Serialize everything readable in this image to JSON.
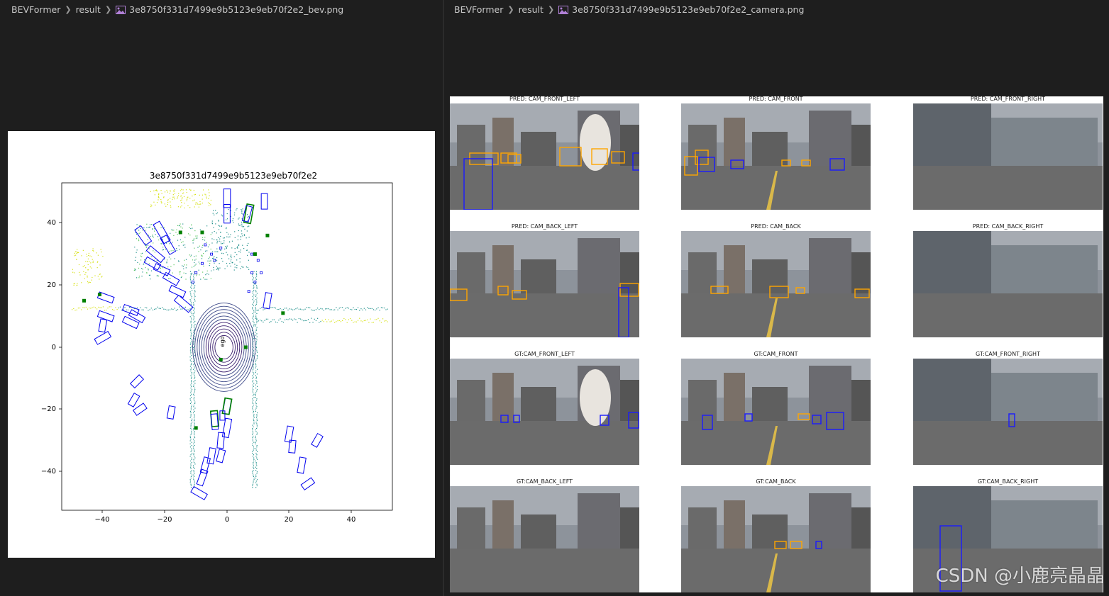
{
  "left_tab": {
    "breadcrumb": [
      "BEVFormer",
      "result",
      "3e8750f331d7499e9b5123e9eb70f2e2_bev.png"
    ],
    "file_icon": "image-file-icon"
  },
  "right_tab": {
    "breadcrumb": [
      "BEVFormer",
      "result",
      "3e8750f331d7499e9b5123e9eb70f2e2_camera.png"
    ],
    "file_icon": "image-file-icon"
  },
  "bev_plot": {
    "title": "3e8750f331d7499e9b5123e9eb70f2e2",
    "ego_label": "ego",
    "x_ticks": [
      "−40",
      "−20",
      "0",
      "20",
      "40"
    ],
    "y_ticks": [
      "40",
      "20",
      "0",
      "−20",
      "−40"
    ],
    "xlim": [
      -53,
      53
    ],
    "ylim": [
      -53,
      53
    ],
    "colors": {
      "pred_box": "#0000ee",
      "gt_box": "#008000",
      "lidar_near": "#3b1f6e",
      "lidar_mid": "#21918c",
      "lidar_far": "#d8e219"
    }
  },
  "camera_grid": {
    "views": [
      {
        "title": "PRED: CAM_FRONT_LEFT"
      },
      {
        "title": "PRED: CAM_FRONT"
      },
      {
        "title": "PRED: CAM_FRONT_RIGHT"
      },
      {
        "title": "PRED: CAM_BACK_LEFT"
      },
      {
        "title": "PRED: CAM_BACK"
      },
      {
        "title": "PRED: CAM_BACK_RIGHT"
      },
      {
        "title": "GT:CAM_FRONT_LEFT"
      },
      {
        "title": "GT:CAM_FRONT"
      },
      {
        "title": "GT:CAM_FRONT_RIGHT"
      },
      {
        "title": "GT:CAM_BACK_LEFT"
      },
      {
        "title": "GT:CAM_BACK"
      },
      {
        "title": "GT:CAM_BACK_RIGHT"
      }
    ],
    "colors": {
      "box_blue": "#1a1aff",
      "box_orange": "#ffa500",
      "sky": "#9aa0a8",
      "road": "#6b6b6b"
    }
  },
  "watermark": "CSDN @小鹿亮晶晶"
}
